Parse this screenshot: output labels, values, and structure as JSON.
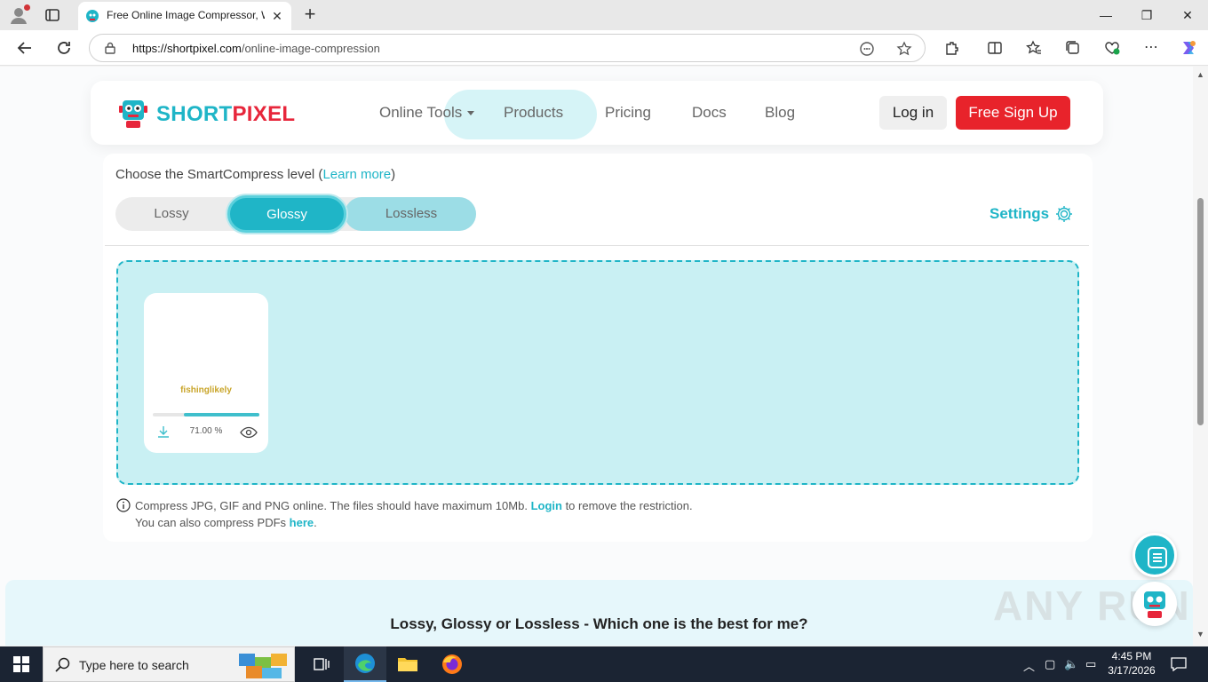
{
  "browser": {
    "tab_title": "Free Online Image Compressor, W",
    "url_domain": "https://shortpixel.com",
    "url_path": "/online-image-compression"
  },
  "nav": {
    "logo_part1": "SHORT",
    "logo_part2": "PIXEL",
    "links": [
      "Online Tools",
      "Products",
      "Pricing",
      "Docs",
      "Blog"
    ],
    "login": "Log in",
    "signup": "Free Sign Up"
  },
  "compress": {
    "level_label": "Choose the SmartCompress level (",
    "learn_more": "Learn more",
    "level_label_end": ")",
    "options": [
      "Lossy",
      "Glossy",
      "Lossless"
    ],
    "selected": "Glossy",
    "settings": "Settings"
  },
  "file": {
    "name": "fishinglikely",
    "percent_label": "71.00 %",
    "progress": 0.71
  },
  "info": {
    "line1_a": "Compress JPG, GIF and PNG online. The files should have maximum 10Mb. ",
    "line1_link": "Login",
    "line1_b": " to remove the restriction.",
    "line2_a": "You can also compress PDFs ",
    "line2_link": "here",
    "line2_b": "."
  },
  "faq_title": "Lossy, Glossy or Lossless - Which one is the best for me?",
  "watermark": "ANY RUN",
  "taskbar": {
    "search_placeholder": "Type here to search",
    "time": "4:45 PM",
    "date": "3/17/2026"
  },
  "colors": {
    "brand_teal": "#1fb5c7",
    "brand_red": "#e8232b"
  }
}
